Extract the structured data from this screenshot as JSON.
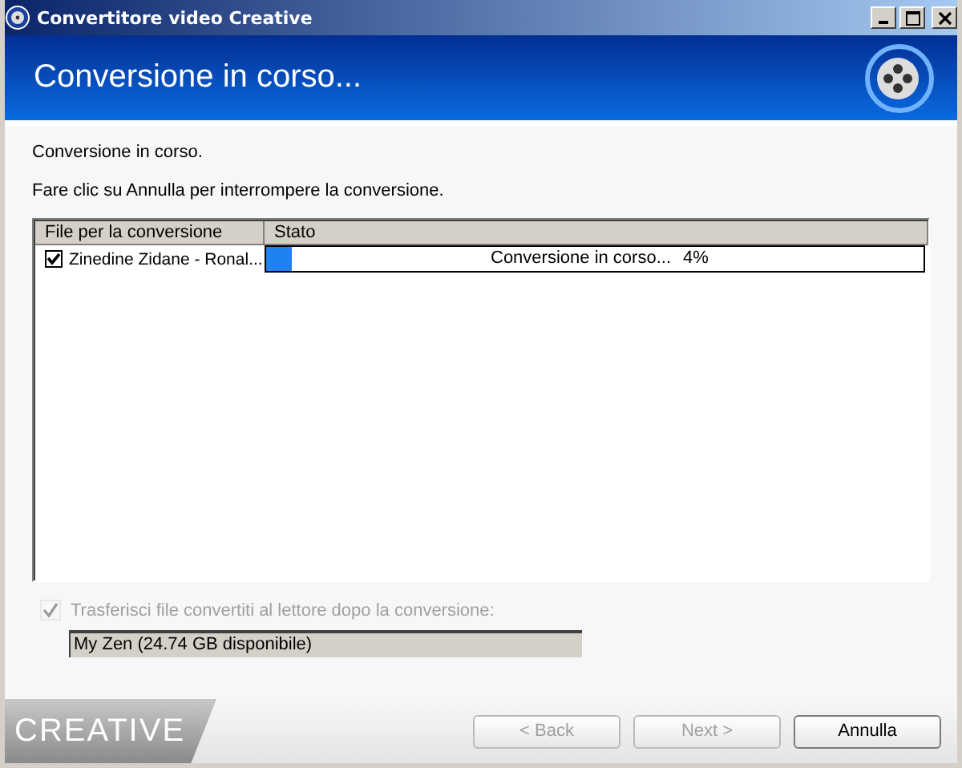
{
  "window": {
    "title": "Convertitore video Creative"
  },
  "header": {
    "title": "Conversione in corso..."
  },
  "status_text": "Conversione in corso.",
  "instruction": "Fare clic su Annulla per interrompere la conversione.",
  "table": {
    "columns": [
      "File per la conversione",
      "Stato"
    ],
    "rows": [
      {
        "file": "Zinedine Zidane - Ronal...",
        "checked": true,
        "status": "Conversione in corso...",
        "percent": "4%",
        "level": 0.04
      }
    ]
  },
  "transfer": {
    "label": "Trasferisci file convertiti al lettore dopo la conversione:",
    "checked": true,
    "disabled": true,
    "device": "My Zen (24.74 GB disponibile)"
  },
  "footer": {
    "logo": "CREATIVE"
  },
  "buttons": [
    {
      "label": "< Back",
      "disabled": true
    },
    {
      "label": "Next >",
      "disabled": true
    },
    {
      "label": "Annulla",
      "disabled": false
    }
  ]
}
